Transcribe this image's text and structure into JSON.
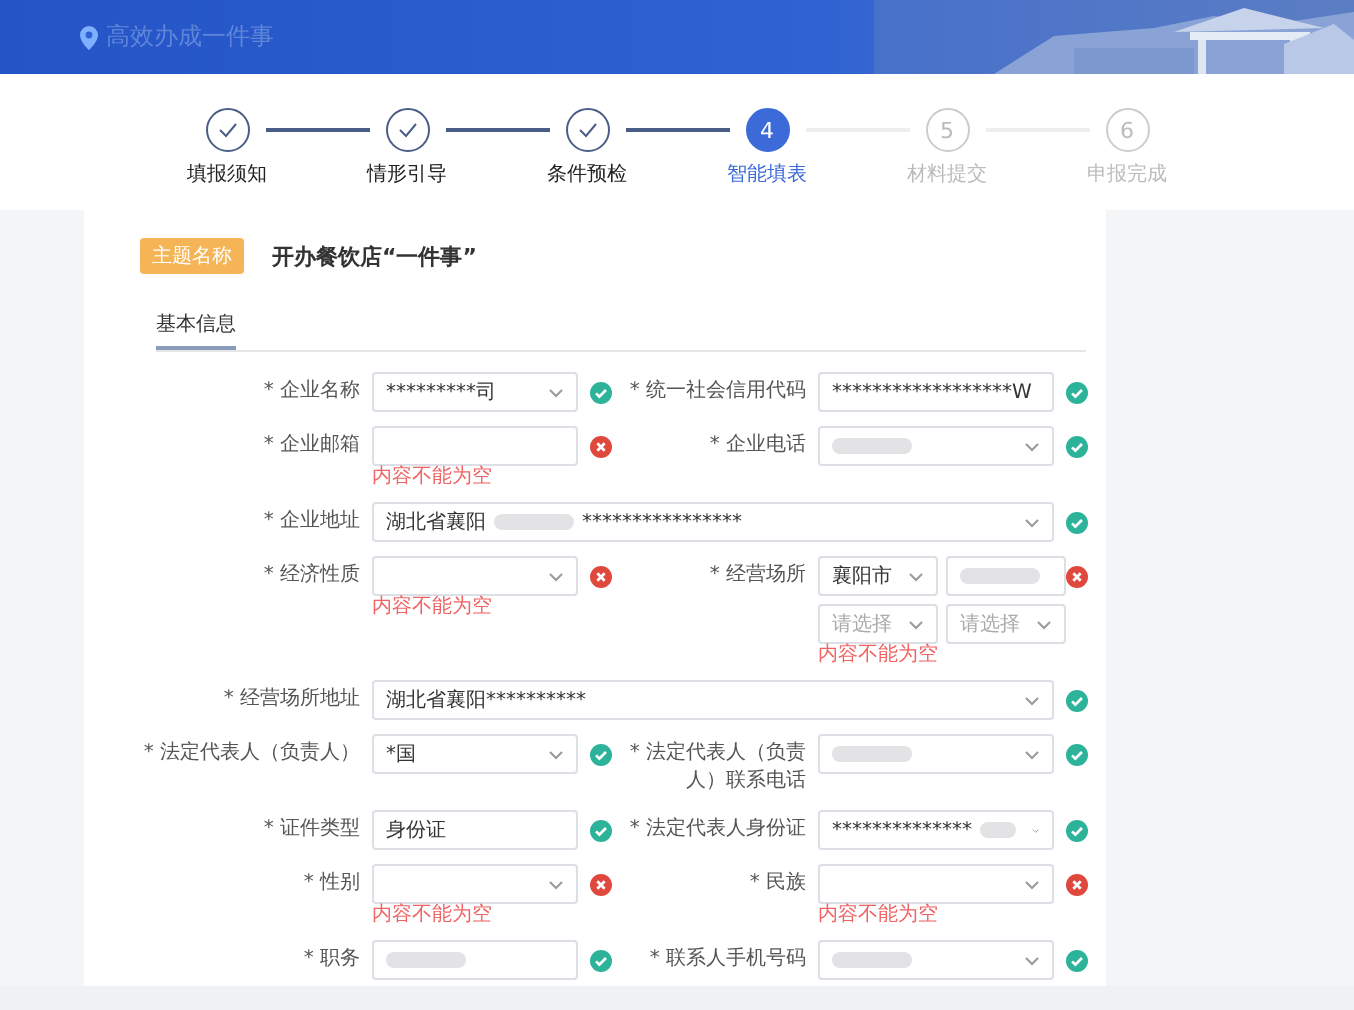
{
  "header": {
    "title": "高效办成一件事"
  },
  "steps": [
    {
      "label": "填报须知",
      "completed": true,
      "selected": false
    },
    {
      "label": "情形引导",
      "completed": true,
      "selected": false
    },
    {
      "label": "条件预检",
      "completed": true,
      "selected": false
    },
    {
      "label": "智能填表",
      "number": "4",
      "completed": false,
      "selected": true
    },
    {
      "label": "材料提交",
      "number": "5",
      "completed": false,
      "selected": false
    },
    {
      "label": "申报完成",
      "number": "6",
      "completed": false,
      "selected": false
    }
  ],
  "card": {
    "tag": "主题名称",
    "title": "开办餐饮店“一件事”",
    "tabs": [
      {
        "label": "基本信息",
        "selected": true
      }
    ],
    "rows": [
      {
        "fields": [
          {
            "label": "* 企业名称",
            "kind": "select",
            "value": "*********司",
            "valid": true
          },
          {
            "label": "* 统一社会信用代码",
            "kind": "select",
            "value": "******************W",
            "valid": true
          }
        ]
      },
      {
        "fields": [
          {
            "label": "* 企业邮箱",
            "kind": "text",
            "valid": false,
            "error": "内容不能为空"
          },
          {
            "label": "* 企业电话",
            "kind": "select",
            "masked": true,
            "valid": true
          }
        ]
      },
      {
        "fields": [
          {
            "label": "* 企业地址",
            "kind": "select",
            "wide": true,
            "value": "湖北省襄阳",
            "masked": true,
            "value_tail": "****************",
            "valid": true
          }
        ]
      },
      {
        "fields": [
          {
            "label": "* 经济性质",
            "kind": "select",
            "valid": false,
            "error": "内容不能为空"
          },
          {
            "label": "* 经营场所",
            "kind": "place",
            "valid": false,
            "error": "内容不能为空",
            "parts": [
              {
                "kind": "select",
                "value": "襄阳市"
              },
              {
                "kind": "text",
                "masked": true
              },
              {
                "kind": "select",
                "placeholder": "请选择"
              },
              {
                "kind": "select",
                "placeholder": "请选择"
              }
            ]
          }
        ]
      },
      {
        "fields": [
          {
            "label": "* 经营场所地址",
            "kind": "select",
            "wide": true,
            "value": "湖北省襄阳**********",
            "valid": true
          }
        ]
      },
      {
        "fields": [
          {
            "label": "* 法定代表人（负责人）",
            "kind": "select",
            "value": "*国",
            "valid": true
          },
          {
            "label": "* 法定代表人（负责人）联系电话",
            "kind": "select",
            "masked": true,
            "valid": true
          }
        ]
      },
      {
        "fields": [
          {
            "label": "* 证件类型",
            "kind": "text",
            "value": "身份证",
            "valid": true
          },
          {
            "label": "* 法定代表人身份证",
            "kind": "select",
            "value": "**************",
            "masked": true,
            "valid": true
          }
        ]
      },
      {
        "fields": [
          {
            "label": "* 性别",
            "kind": "select",
            "valid": false,
            "error": "内容不能为空"
          },
          {
            "label": "* 民族",
            "kind": "select",
            "valid": false,
            "error": "内容不能为空"
          }
        ]
      },
      {
        "fields": [
          {
            "label": "* 职务",
            "kind": "text",
            "masked": true,
            "valid": true
          },
          {
            "label": "* 联系人手机号码",
            "kind": "select",
            "masked": true,
            "valid": true
          }
        ]
      }
    ]
  }
}
